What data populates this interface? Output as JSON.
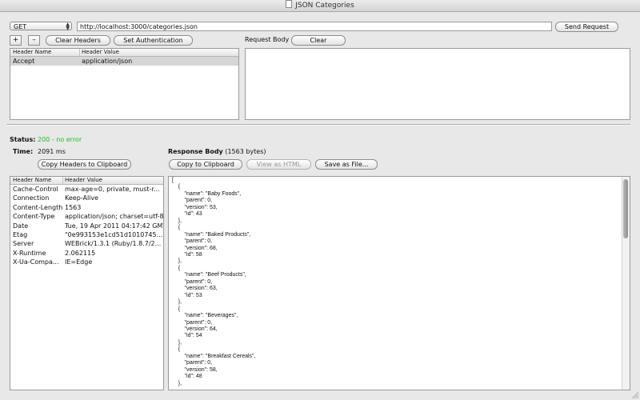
{
  "window": {
    "title": "JSON Categories"
  },
  "request": {
    "method": "GET",
    "url": "http://localhost:3000/categories.json",
    "send_label": "Send Request",
    "add_label": "+",
    "remove_label": "–",
    "clear_headers_label": "Clear Headers",
    "set_auth_label": "Set Authentication",
    "body_label": "Request Body",
    "clear_body_label": "Clear",
    "body": "",
    "headers_table": {
      "columns": [
        "Header Name",
        "Header Value"
      ],
      "rows": [
        {
          "name": "Accept",
          "value": "application/json"
        }
      ]
    }
  },
  "response": {
    "status_label": "Status:",
    "status_value": "200 - no error",
    "time_label": "Time:",
    "time_value": "2091 ms",
    "copy_headers_label": "Copy Headers to Clipboard",
    "body_label": "Response Body",
    "body_size": "(1563 bytes)",
    "copy_clipboard_label": "Copy to Clipboard",
    "view_html_label": "View as HTML",
    "save_file_label": "Save as File...",
    "headers_table": {
      "columns": [
        "Header Name",
        "Header Value"
      ],
      "rows": [
        {
          "name": "Cache-Control",
          "value": "max-age=0, private, must-r..."
        },
        {
          "name": "Connection",
          "value": "Keep-Alive"
        },
        {
          "name": "Content-Length",
          "value": "1563"
        },
        {
          "name": "Content-Type",
          "value": "application/json; charset=utf-8"
        },
        {
          "name": "Date",
          "value": "Tue, 19 Apr 2011 04:17:42 GMT"
        },
        {
          "name": "Etag",
          "value": "\"0e993153e1cd51d1010745..."
        },
        {
          "name": "Server",
          "value": "WEBrick/1.3.1 (Ruby/1.8.7/2..."
        },
        {
          "name": "X-Runtime",
          "value": "2.062115"
        },
        {
          "name": "X-Ua-Compa...",
          "value": "IE=Edge"
        }
      ]
    },
    "body": "[\n    {\n        \"name\": \"Baby Foods\",\n        \"parent\": 0,\n        \"version\": 53,\n        \"id\": 43\n    },\n    {\n        \"name\": \"Baked Products\",\n        \"parent\": 0,\n        \"version\": 68,\n        \"id\": 58\n    },\n    {\n        \"name\": \"Beef Products\",\n        \"parent\": 0,\n        \"version\": 63,\n        \"id\": 53\n    },\n    {\n        \"name\": \"Beverages\",\n        \"parent\": 0,\n        \"version\": 64,\n        \"id\": 54\n    },\n    {\n        \"name\": \"Breakfast Cereals\",\n        \"parent\": 0,\n        \"version\": 58,\n        \"id\": 48\n    },"
  },
  "colors": {
    "status_ok": "#22bb22",
    "selected_row": "#d6d6d6"
  }
}
